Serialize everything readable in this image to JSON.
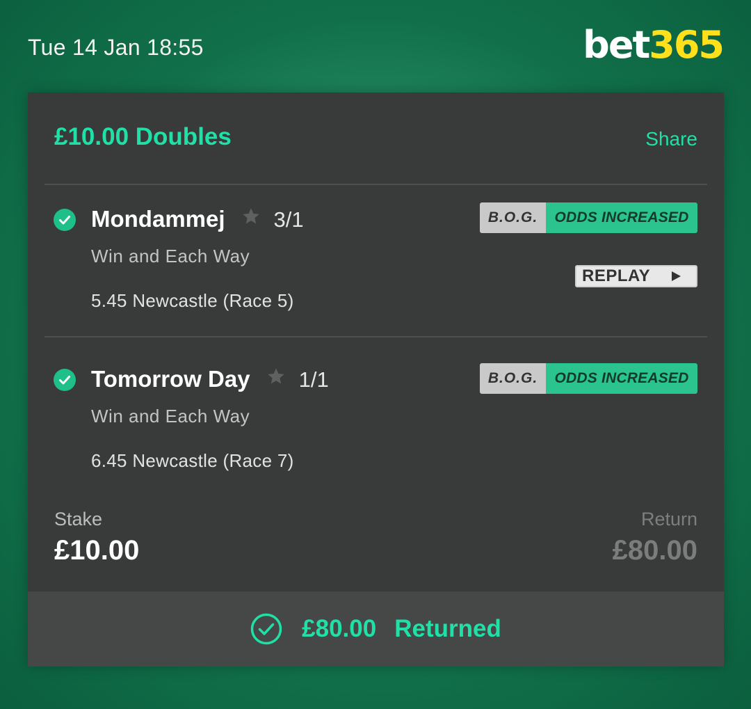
{
  "header": {
    "datetime": "Tue 14 Jan 18:55",
    "logo_bet": "bet",
    "logo_num": "365"
  },
  "bet": {
    "title": "£10.00 Doubles",
    "share_label": "Share",
    "selections": [
      {
        "name": "Mondammej",
        "odds": "3/1",
        "market": "Win and Each Way",
        "race": "5.45 Newcastle (Race 5)",
        "badge_bog": "B.O.G.",
        "badge_increase": "ODDS INCREASED",
        "replay_label": "REPLAY"
      },
      {
        "name": "Tomorrow Day",
        "odds": "1/1",
        "market": "Win and Each Way",
        "race": "6.45 Newcastle (Race 7)",
        "badge_bog": "B.O.G.",
        "badge_increase": "ODDS INCREASED"
      }
    ],
    "stake_label": "Stake",
    "stake_value": "£10.00",
    "return_label": "Return",
    "return_value": "£80.00",
    "returned_amount": "£80.00",
    "returned_label": "Returned"
  },
  "colors": {
    "accent": "#1fe0a6",
    "card_bg": "#383b3a",
    "footer_bg": "#454847",
    "logo_yellow": "#ffe01a"
  },
  "icons": {
    "check": "check-circle-icon",
    "favourite": "star-icon",
    "replay": "play-icon",
    "returned": "check-circle-outline-icon"
  }
}
